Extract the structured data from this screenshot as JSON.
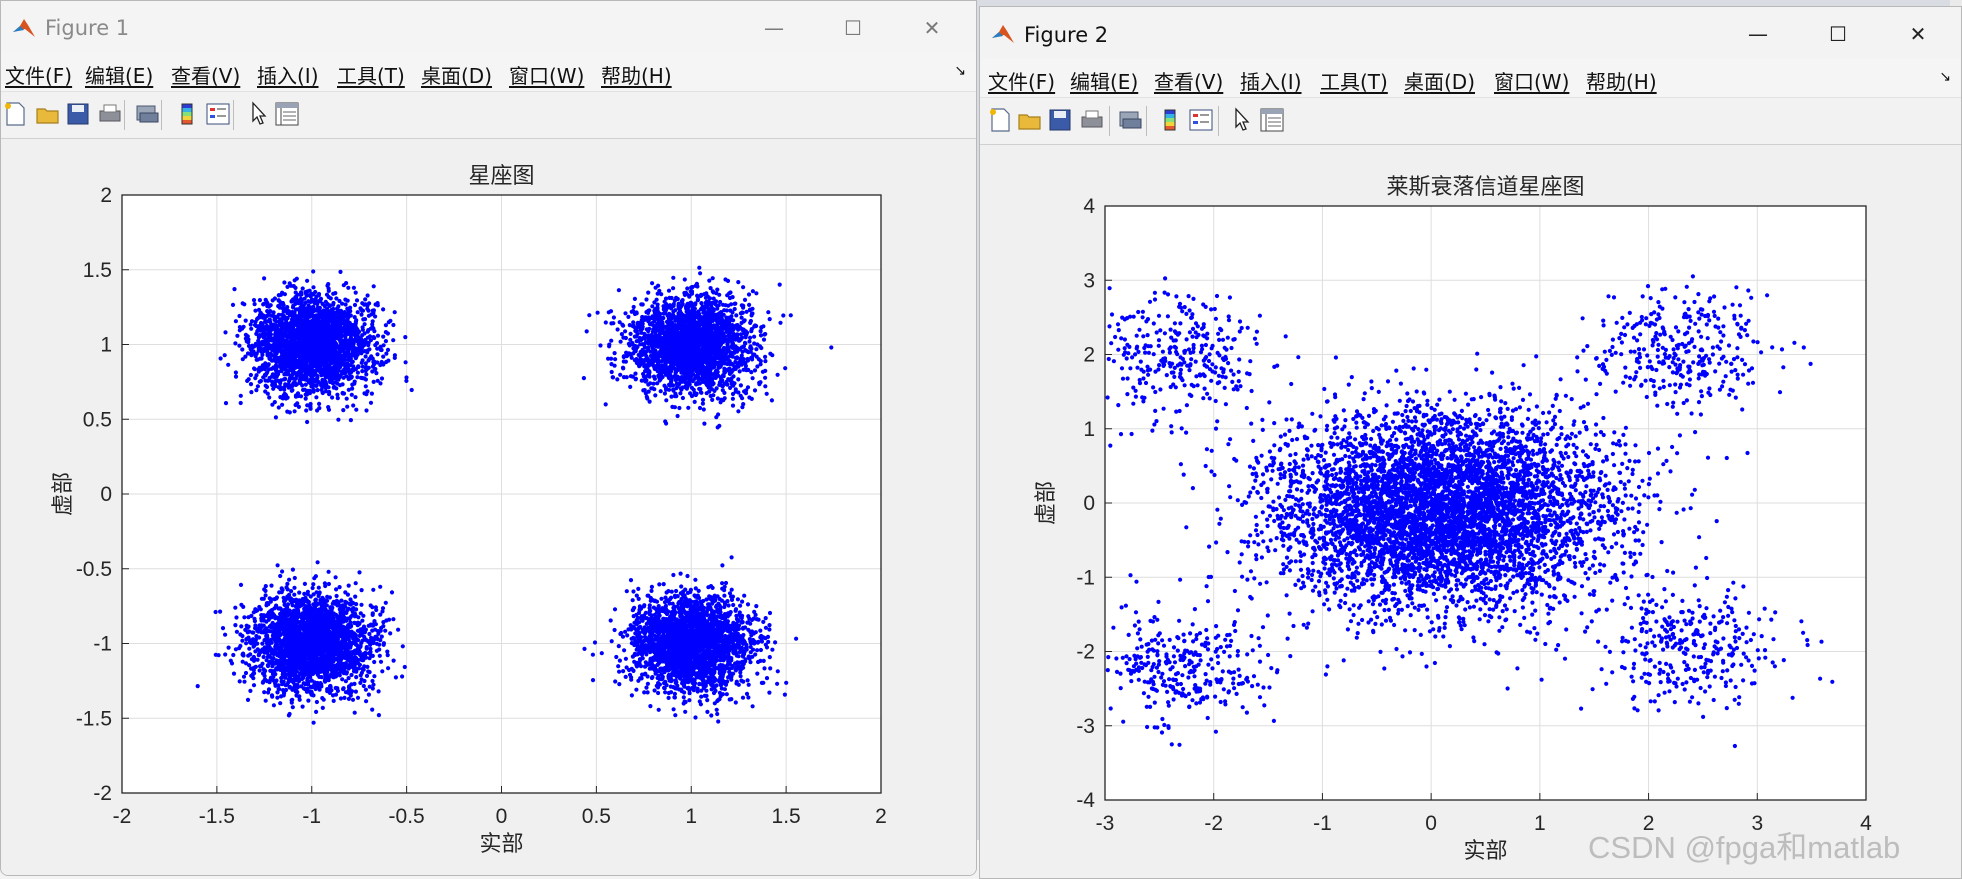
{
  "windows": [
    {
      "title": "Figure 1",
      "menu": [
        "文件(F)",
        "编辑(E)",
        "查看(V)",
        "插入(I)",
        "工具(T)",
        "桌面(D)",
        "窗口(W)",
        "帮助(H)"
      ],
      "toolbar_icons": [
        "new-file-icon",
        "open-folder-icon",
        "save-icon",
        "print-icon",
        "print-preview-icon",
        "colorbar-icon",
        "legend-icon",
        "pointer-icon",
        "property-inspector-icon"
      ],
      "chart_data": {
        "type": "scatter",
        "title": "星座图",
        "xlabel": "实部",
        "ylabel": "虚部",
        "xlim": [
          -2,
          2
        ],
        "ylim": [
          -2,
          2
        ],
        "xticks": [
          "-2",
          "-1.5",
          "-1",
          "-0.5",
          "0",
          "0.5",
          "1",
          "1.5",
          "2"
        ],
        "yticks": [
          "-2",
          "-1.5",
          "-1",
          "-0.5",
          "0",
          "0.5",
          "1",
          "1.5",
          "2"
        ],
        "grid": true,
        "marker_color": "#0000ff",
        "clusters": [
          {
            "x": -1,
            "y": 1,
            "spread": 0.16
          },
          {
            "x": 1,
            "y": 1,
            "spread": 0.16
          },
          {
            "x": -1,
            "y": -1,
            "spread": 0.16
          },
          {
            "x": 1,
            "y": -1,
            "spread": 0.16
          }
        ],
        "points_per_cluster": 2500
      }
    },
    {
      "title": "Figure 2",
      "menu": [
        "文件(F)",
        "编辑(E)",
        "查看(V)",
        "插入(I)",
        "工具(T)",
        "桌面(D)",
        "窗口(W)",
        "帮助(H)"
      ],
      "toolbar_icons": [
        "new-file-icon",
        "open-folder-icon",
        "save-icon",
        "print-icon",
        "print-preview-icon",
        "colorbar-icon",
        "legend-icon",
        "pointer-icon",
        "property-inspector-icon"
      ],
      "chart_data": {
        "type": "scatter",
        "title": "莱斯衰落信道星座图",
        "xlabel": "实部",
        "ylabel": "虚部",
        "xlim": [
          -3,
          4
        ],
        "ylim": [
          -4,
          4
        ],
        "xticks": [
          "-3",
          "-2",
          "-1",
          "0",
          "1",
          "2",
          "3",
          "4"
        ],
        "yticks": [
          "-4",
          "-3",
          "-2",
          "-1",
          "0",
          "1",
          "2",
          "3",
          "4"
        ],
        "grid": true,
        "marker_color": "#0000ff",
        "core": {
          "x": 0.1,
          "y": -0.1,
          "spread_x": 0.75,
          "spread_y": 0.65,
          "count": 5500
        },
        "corners": [
          {
            "x": -2.4,
            "y": 2.0,
            "spread": 0.4
          },
          {
            "x": 2.3,
            "y": 2.1,
            "spread": 0.4
          },
          {
            "x": -2.3,
            "y": -2.2,
            "spread": 0.4
          },
          {
            "x": 2.4,
            "y": -1.9,
            "spread": 0.4
          }
        ],
        "corner_count": 320
      }
    }
  ],
  "watermark": "CSDN @fpga和matlab"
}
